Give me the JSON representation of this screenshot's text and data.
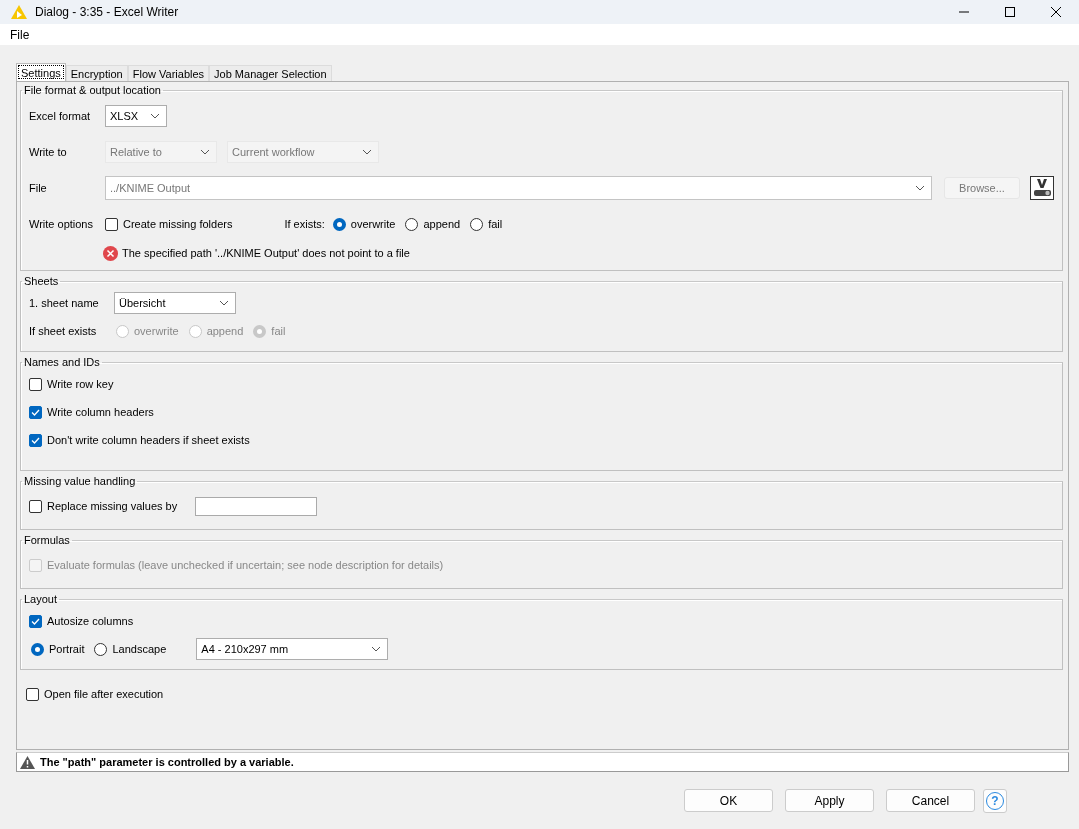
{
  "window": {
    "title": "Dialog - 3:35 - Excel Writer"
  },
  "menu": [
    {
      "label": "File"
    }
  ],
  "tabs": [
    {
      "label": "Settings",
      "selected": true
    },
    {
      "label": "Encryption",
      "selected": false
    },
    {
      "label": "Flow Variables",
      "selected": false
    },
    {
      "label": "Job Manager Selection",
      "selected": false
    }
  ],
  "sections": [
    {
      "title": "File format & output location",
      "rows": [
        [
          {
            "kind": "label",
            "text": "Excel format"
          },
          {
            "kind": "dropdown",
            "value": "XLSX",
            "disabled": false
          }
        ],
        [
          {
            "kind": "label",
            "text": "Write to"
          },
          {
            "kind": "dropdown",
            "value": "Relative to",
            "disabled": true
          },
          {
            "kind": "dropdown",
            "value": "Current workflow",
            "disabled": true
          }
        ],
        [
          {
            "kind": "label",
            "text": "File"
          },
          {
            "kind": "path",
            "value": "../KNIME Output",
            "disabled": true
          },
          {
            "kind": "button",
            "label": "Browse...",
            "disabled": true
          },
          {
            "kind": "variable-button"
          }
        ],
        [
          {
            "kind": "label",
            "text": "Write options"
          },
          {
            "kind": "checkbox",
            "label": "Create missing folders",
            "checked": false,
            "disabled": false
          },
          {
            "kind": "label",
            "text": "If exists:"
          },
          {
            "kind": "radio",
            "label": "overwrite",
            "selected": true,
            "disabled": false
          },
          {
            "kind": "radio",
            "label": "append",
            "selected": false,
            "disabled": false
          },
          {
            "kind": "radio",
            "label": "fail",
            "selected": false,
            "disabled": false
          }
        ]
      ],
      "error": "The specified path '../KNIME Output' does not point to a file"
    },
    {
      "title": "Sheets",
      "rows": [
        [
          {
            "kind": "label",
            "text": "1. sheet name"
          },
          {
            "kind": "dropdown",
            "value": "Übersicht",
            "disabled": false
          }
        ],
        [
          {
            "kind": "label",
            "text": "If sheet exists"
          },
          {
            "kind": "radio",
            "label": "overwrite",
            "selected": false,
            "disabled": true
          },
          {
            "kind": "radio",
            "label": "append",
            "selected": false,
            "disabled": true
          },
          {
            "kind": "radio",
            "label": "fail",
            "selected": true,
            "disabled": true
          }
        ]
      ]
    },
    {
      "title": "Names and IDs",
      "rows": [
        [
          {
            "kind": "checkbox",
            "label": "Write row key",
            "checked": false,
            "disabled": false
          }
        ],
        [
          {
            "kind": "checkbox",
            "label": "Write column headers",
            "checked": true,
            "disabled": false
          }
        ],
        [
          {
            "kind": "checkbox",
            "label": "Don't write column headers if sheet exists",
            "checked": true,
            "disabled": false
          }
        ]
      ]
    },
    {
      "title": "Missing value handling",
      "rows": [
        [
          {
            "kind": "checkbox",
            "label": "Replace missing values by",
            "checked": false,
            "disabled": false
          },
          {
            "kind": "field"
          }
        ]
      ]
    },
    {
      "title": "Formulas",
      "rows": [
        [
          {
            "kind": "checkbox",
            "label": "Evaluate formulas (leave unchecked if uncertain; see node description for details)",
            "checked": false,
            "disabled": true
          }
        ]
      ]
    },
    {
      "title": "Layout",
      "rows": [
        [
          {
            "kind": "checkbox",
            "label": "Autosize columns",
            "checked": true,
            "disabled": false
          }
        ],
        [
          {
            "kind": "radio",
            "label": "Portrait",
            "selected": true,
            "disabled": false
          },
          {
            "kind": "radio",
            "label": "Landscape",
            "selected": false,
            "disabled": false
          },
          {
            "kind": "dropdown",
            "value": "A4 - 210x297 mm",
            "disabled": false
          }
        ]
      ]
    }
  ],
  "after": [
    {
      "kind": "checkbox",
      "label": "Open file after execution",
      "checked": false,
      "disabled": false
    }
  ],
  "warning": {
    "text": "The \"path\" parameter is controlled by a variable."
  },
  "buttons": [
    {
      "kind": "text",
      "label": "OK"
    },
    {
      "kind": "text",
      "label": "Apply"
    },
    {
      "kind": "text",
      "label": "Cancel"
    },
    {
      "kind": "help",
      "label": "?"
    }
  ]
}
